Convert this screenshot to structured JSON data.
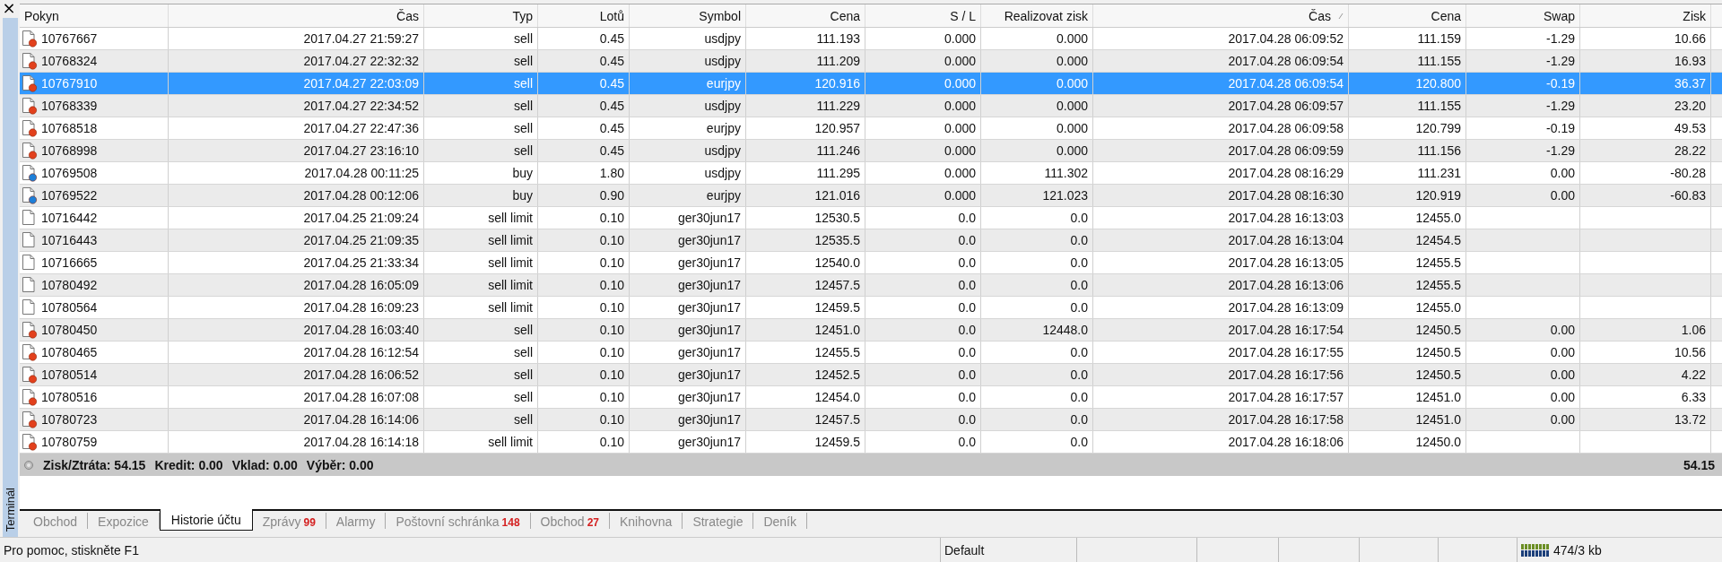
{
  "side_panel": {
    "close": "×",
    "title": "Terminál"
  },
  "table": {
    "columns": [
      {
        "label": "Pokyn",
        "sorted": false
      },
      {
        "label": "Čas",
        "sorted": false
      },
      {
        "label": "Typ",
        "sorted": false
      },
      {
        "label": "Lotů",
        "sorted": false
      },
      {
        "label": "Symbol",
        "sorted": false
      },
      {
        "label": "Cena",
        "sorted": false
      },
      {
        "label": "S / L",
        "sorted": false
      },
      {
        "label": "Realizovat zisk",
        "sorted": false
      },
      {
        "label": "Čas",
        "sorted": true
      },
      {
        "label": "Cena",
        "sorted": false
      },
      {
        "label": "Swap",
        "sorted": false
      },
      {
        "label": "Zisk",
        "sorted": false
      }
    ],
    "rows": [
      {
        "selected": false,
        "kind": "sell",
        "cells": [
          "10767667",
          "2017.04.27 21:59:27",
          "sell",
          "0.45",
          "usdjpy",
          "111.193",
          "0.000",
          "0.000",
          "2017.04.28 06:09:52",
          "111.159",
          "-1.29",
          "10.66"
        ]
      },
      {
        "selected": false,
        "kind": "sell",
        "cells": [
          "10768324",
          "2017.04.27 22:32:32",
          "sell",
          "0.45",
          "usdjpy",
          "111.209",
          "0.000",
          "0.000",
          "2017.04.28 06:09:54",
          "111.155",
          "-1.29",
          "16.93"
        ]
      },
      {
        "selected": true,
        "kind": "sell",
        "cells": [
          "10767910",
          "2017.04.27 22:03:09",
          "sell",
          "0.45",
          "eurjpy",
          "120.916",
          "0.000",
          "0.000",
          "2017.04.28 06:09:54",
          "120.800",
          "-0.19",
          "36.37"
        ]
      },
      {
        "selected": false,
        "kind": "sell",
        "cells": [
          "10768339",
          "2017.04.27 22:34:52",
          "sell",
          "0.45",
          "usdjpy",
          "111.229",
          "0.000",
          "0.000",
          "2017.04.28 06:09:57",
          "111.155",
          "-1.29",
          "23.20"
        ]
      },
      {
        "selected": false,
        "kind": "sell",
        "cells": [
          "10768518",
          "2017.04.27 22:47:36",
          "sell",
          "0.45",
          "eurjpy",
          "120.957",
          "0.000",
          "0.000",
          "2017.04.28 06:09:58",
          "120.799",
          "-0.19",
          "49.53"
        ]
      },
      {
        "selected": false,
        "kind": "sell",
        "cells": [
          "10768998",
          "2017.04.27 23:16:10",
          "sell",
          "0.45",
          "usdjpy",
          "111.246",
          "0.000",
          "0.000",
          "2017.04.28 06:09:59",
          "111.156",
          "-1.29",
          "28.22"
        ]
      },
      {
        "selected": false,
        "kind": "buy",
        "cells": [
          "10769508",
          "2017.04.28 00:11:25",
          "buy",
          "1.80",
          "usdjpy",
          "111.295",
          "0.000",
          "111.302",
          "2017.04.28 08:16:29",
          "111.231",
          "0.00",
          "-80.28"
        ]
      },
      {
        "selected": false,
        "kind": "buy",
        "cells": [
          "10769522",
          "2017.04.28 00:12:06",
          "buy",
          "0.90",
          "eurjpy",
          "121.016",
          "0.000",
          "121.023",
          "2017.04.28 08:16:30",
          "120.919",
          "0.00",
          "-60.83"
        ]
      },
      {
        "selected": false,
        "kind": "pending",
        "cells": [
          "10716442",
          "2017.04.25 21:09:24",
          "sell limit",
          "0.10",
          "ger30jun17",
          "12530.5",
          "0.0",
          "0.0",
          "2017.04.28 16:13:03",
          "12455.0"
        ]
      },
      {
        "selected": false,
        "kind": "pending",
        "cells": [
          "10716443",
          "2017.04.25 21:09:35",
          "sell limit",
          "0.10",
          "ger30jun17",
          "12535.5",
          "0.0",
          "0.0",
          "2017.04.28 16:13:04",
          "12454.5"
        ]
      },
      {
        "selected": false,
        "kind": "pending",
        "cells": [
          "10716665",
          "2017.04.25 21:33:34",
          "sell limit",
          "0.10",
          "ger30jun17",
          "12540.0",
          "0.0",
          "0.0",
          "2017.04.28 16:13:05",
          "12455.5"
        ]
      },
      {
        "selected": false,
        "kind": "pending",
        "cells": [
          "10780492",
          "2017.04.28 16:05:09",
          "sell limit",
          "0.10",
          "ger30jun17",
          "12457.5",
          "0.0",
          "0.0",
          "2017.04.28 16:13:06",
          "12455.5"
        ]
      },
      {
        "selected": false,
        "kind": "pending",
        "cells": [
          "10780564",
          "2017.04.28 16:09:23",
          "sell limit",
          "0.10",
          "ger30jun17",
          "12459.5",
          "0.0",
          "0.0",
          "2017.04.28 16:13:09",
          "12455.0"
        ]
      },
      {
        "selected": false,
        "kind": "sell",
        "cells": [
          "10780450",
          "2017.04.28 16:03:40",
          "sell",
          "0.10",
          "ger30jun17",
          "12451.0",
          "0.0",
          "12448.0",
          "2017.04.28 16:17:54",
          "12450.5",
          "0.00",
          "1.06"
        ]
      },
      {
        "selected": false,
        "kind": "sell",
        "cells": [
          "10780465",
          "2017.04.28 16:12:54",
          "sell",
          "0.10",
          "ger30jun17",
          "12455.5",
          "0.0",
          "0.0",
          "2017.04.28 16:17:55",
          "12450.5",
          "0.00",
          "10.56"
        ]
      },
      {
        "selected": false,
        "kind": "sell",
        "cells": [
          "10780514",
          "2017.04.28 16:06:52",
          "sell",
          "0.10",
          "ger30jun17",
          "12452.5",
          "0.0",
          "0.0",
          "2017.04.28 16:17:56",
          "12450.5",
          "0.00",
          "4.22"
        ]
      },
      {
        "selected": false,
        "kind": "sell",
        "cells": [
          "10780516",
          "2017.04.28 16:07:08",
          "sell",
          "0.10",
          "ger30jun17",
          "12454.0",
          "0.0",
          "0.0",
          "2017.04.28 16:17:57",
          "12451.0",
          "0.00",
          "6.33"
        ]
      },
      {
        "selected": false,
        "kind": "sell",
        "cells": [
          "10780723",
          "2017.04.28 16:14:06",
          "sell",
          "0.10",
          "ger30jun17",
          "12457.5",
          "0.0",
          "0.0",
          "2017.04.28 16:17:58",
          "12451.0",
          "0.00",
          "13.72"
        ]
      },
      {
        "selected": false,
        "kind": "sell",
        "cells": [
          "10780759",
          "2017.04.28 16:14:18",
          "sell limit",
          "0.10",
          "ger30jun17",
          "12459.5",
          "0.0",
          "0.0",
          "2017.04.28 16:18:06",
          "12450.0"
        ]
      }
    ],
    "summary": {
      "items": [
        "Zisk/Ztráta: 54.15",
        "Kredit: 0.00",
        "Vklad: 0.00",
        "Výběr: 0.00"
      ],
      "total": "54.15"
    }
  },
  "tabs": [
    {
      "label": "Obchod",
      "selected": false
    },
    {
      "label": "Expozice",
      "selected": false
    },
    {
      "label": "Historie účtu",
      "selected": true
    },
    {
      "label": "Zprávy",
      "badge": "99",
      "selected": false
    },
    {
      "label": "Alarmy",
      "selected": false
    },
    {
      "label": "Poštovní schránka",
      "badge": "148",
      "selected": false
    },
    {
      "label": "Obchod",
      "badge": "27",
      "selected": false
    },
    {
      "label": "Knihovna",
      "selected": false
    },
    {
      "label": "Strategie",
      "selected": false
    },
    {
      "label": "Deník",
      "selected": false
    }
  ],
  "status_bar": {
    "help": "Pro pomoc, stiskněte F1",
    "profile": "Default",
    "traffic": "474/3 kb"
  }
}
